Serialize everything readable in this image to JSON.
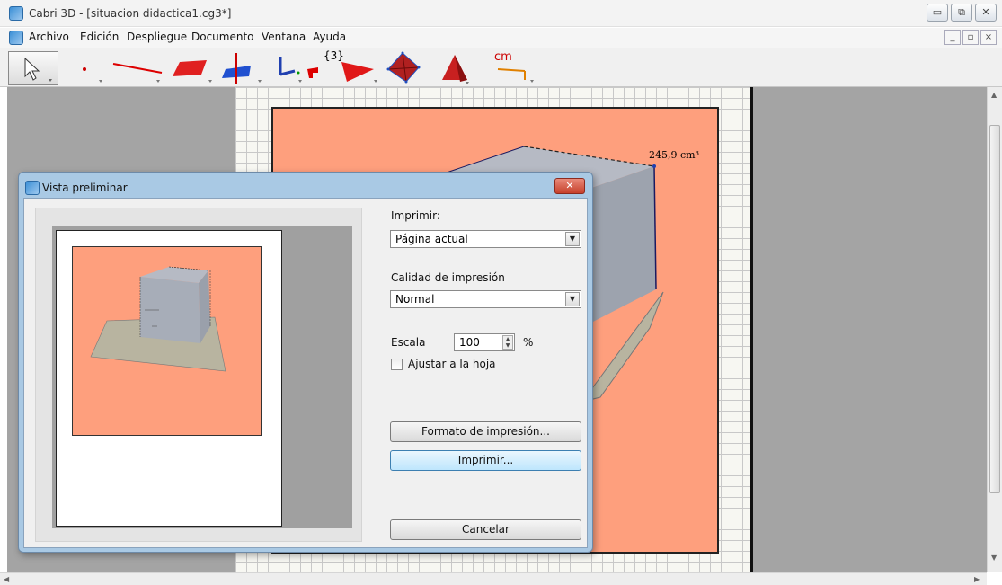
{
  "window": {
    "title": "Cabri 3D - [situacion didactica1.cg3*]",
    "controls": [
      "▭",
      "⧉",
      "✕"
    ]
  },
  "menu": {
    "items": [
      "Archivo",
      "Edición",
      "Despliegue",
      "Documento",
      "Ventana",
      "Ayuda"
    ],
    "mdi_controls": [
      "_",
      "▫",
      "×"
    ]
  },
  "toolbar": {
    "tools": [
      "pointer-tool",
      "point-tool",
      "line-tool",
      "plane-tool",
      "perpendicular-tool",
      "angle-tool",
      "regular-polygon-tool",
      "polyhedron-tool",
      "pyramid-tool",
      "measure-tool"
    ],
    "regular_polygon_label": "{3}",
    "measure_label": "cm"
  },
  "canvas": {
    "volume_label": "245,9 cm³"
  },
  "dialog": {
    "title": "Vista preliminar",
    "close": "✕",
    "print_label": "Imprimir:",
    "print_selected": "Página actual",
    "quality_label": "Calidad de impresión",
    "quality_selected": "Normal",
    "scale_label": "Escala",
    "scale_value": "100",
    "scale_unit": "%",
    "fit_label": "Ajustar a la hoja",
    "fit_checked": false,
    "format_button": "Formato de impresión...",
    "print_button": "Imprimir...",
    "cancel_button": "Cancelar"
  },
  "colors": {
    "peach": "#fe9f7d",
    "cube": "#a7adb8",
    "floor": "#b8b4a0",
    "dialog_frame": "#a9c9e4",
    "focus_button": "#bee6fd"
  }
}
